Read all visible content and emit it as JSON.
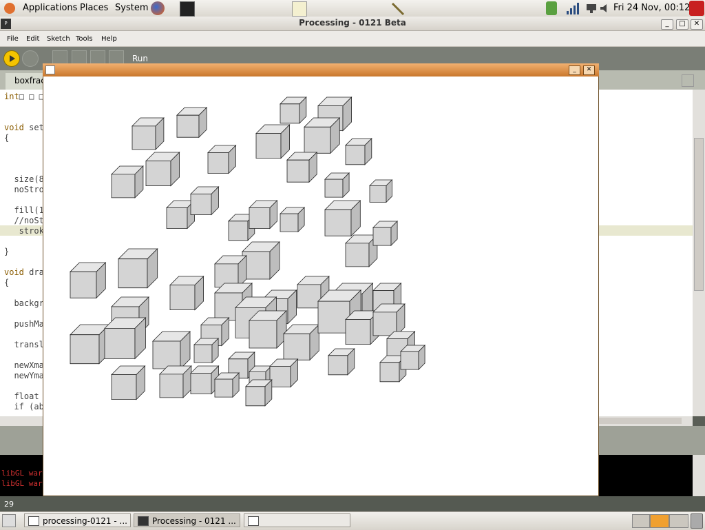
{
  "top_panel": {
    "menus": [
      "Applications",
      "Places",
      "System"
    ],
    "clock": "Fri 24 Nov, 00:12"
  },
  "window": {
    "title": "Processing - 0121 Beta",
    "menu": [
      "File",
      "Edit",
      "Sketch",
      "Tools",
      "Help"
    ],
    "run_label": "Run",
    "tab_label": "boxfrac",
    "line_number": "29"
  },
  "code_lines": [
    {
      "kw": "int",
      "rest": "□ □ □"
    },
    {
      "kw": "void",
      "rest": " setu"
    },
    {
      "kw": "",
      "rest": "{"
    },
    {
      "kw": "",
      "rest": "  size(8"
    },
    {
      "kw": "",
      "rest": "  noStro"
    },
    {
      "kw": "",
      "rest": "  fill(1"
    },
    {
      "kw": "",
      "rest": "  //noSt"
    },
    {
      "kw": "",
      "rest": "   strok"
    },
    {
      "kw": "",
      "rest": "}"
    },
    {
      "kw": "void",
      "rest": " dra"
    },
    {
      "kw": "",
      "rest": "{"
    },
    {
      "kw": "",
      "rest": "  backgr"
    },
    {
      "kw": "",
      "rest": "  pushMa"
    },
    {
      "kw": "",
      "rest": "  transl"
    },
    {
      "kw": "",
      "rest": "  newXma"
    },
    {
      "kw": "",
      "rest": "  newYma"
    },
    {
      "kw": "",
      "rest": "  float"
    },
    {
      "kw": "",
      "rest": "  if (ab"
    }
  ],
  "console": [
    "libGL war",
    "libGL war"
  ],
  "taskbar": {
    "tasks": [
      "processing-0121 - ...",
      "Processing - 0121 ...",
      ""
    ]
  },
  "colors": {
    "accent": "#f0a030",
    "run": "#f5c400"
  }
}
